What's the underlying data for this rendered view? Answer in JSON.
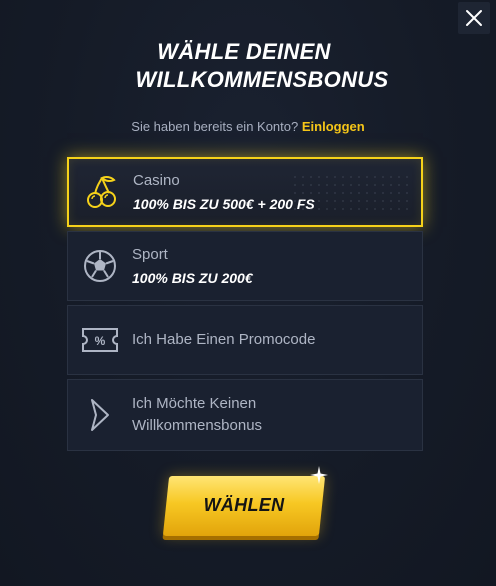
{
  "dialog": {
    "title_line1": "WÄHLE DEINEN",
    "title_line2": "WILLKOMMENSBONUS",
    "login_prompt": "Sie haben bereits ein Konto?",
    "login_link": "Einloggen"
  },
  "options": [
    {
      "icon": "cherries-icon",
      "label": "Casino",
      "sub": "100% BIS ZU 500€ + 200 FS",
      "selected": true
    },
    {
      "icon": "soccer-ball-icon",
      "label": "Sport",
      "sub": "100% BIS ZU 200€",
      "selected": false
    },
    {
      "icon": "promo-ticket-icon",
      "label": "Ich Habe Einen Promocode"
    },
    {
      "icon": "chevron-right-icon",
      "label_line1": "Ich Möchte Keinen",
      "label_line2": "Willkommensbonus"
    }
  ],
  "button": {
    "label": "WÄHLEN"
  },
  "colors": {
    "accent": "#f6d21a",
    "background": "#141a26",
    "card": "#1a2130",
    "muted": "#aeb5c4"
  }
}
